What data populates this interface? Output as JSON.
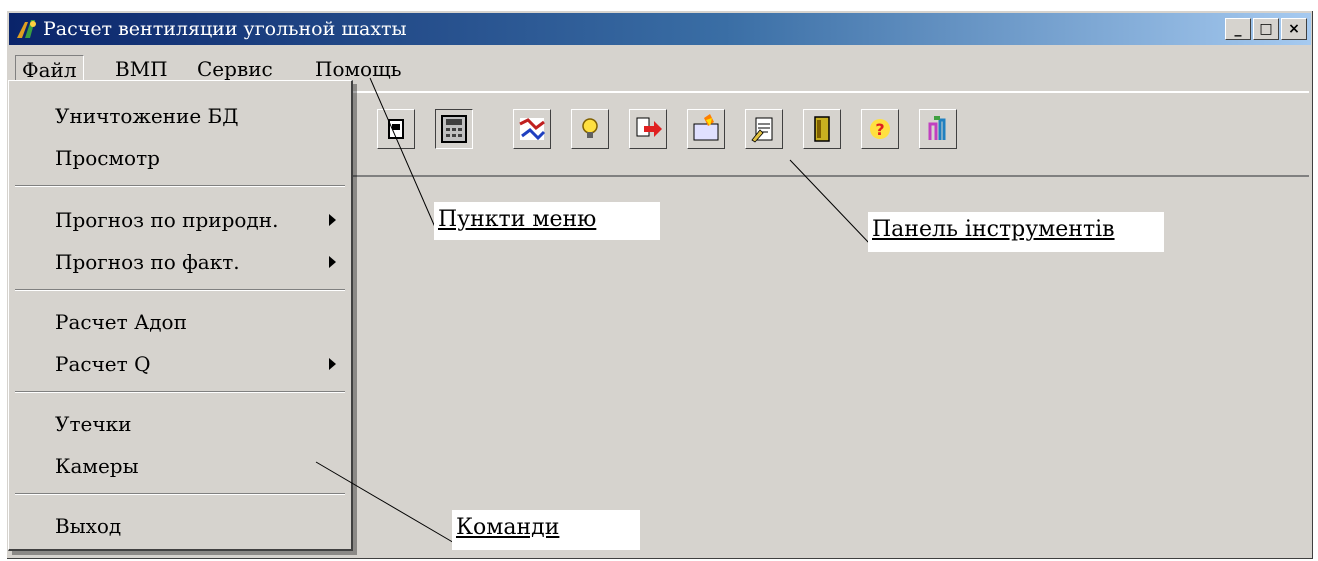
{
  "window": {
    "title": "Расчет вентиляции угольной шахты",
    "controls": [
      "_",
      "□",
      "×"
    ]
  },
  "menubar": {
    "items": [
      "Файл",
      "ВМП",
      "Сервис",
      "Помощь"
    ]
  },
  "dropdown": {
    "items": [
      {
        "label": "Уничтожение БД"
      },
      {
        "label": "Просмотр"
      },
      {
        "label": "Прогноз по природн."
      },
      {
        "label": "Прогноз по факт."
      },
      {
        "label": "Расчет Адоп"
      },
      {
        "label": "Расчет Q"
      },
      {
        "label": "Утечки"
      },
      {
        "label": "Камеры"
      },
      {
        "label": "Выход"
      }
    ]
  },
  "toolbar": {
    "buttons": [
      "list-icon",
      "calculator-icon",
      "map-icon",
      "lightbulb-icon",
      "export-arrow-icon",
      "fire-icon",
      "document-edit-icon",
      "door-icon",
      "help-icon",
      "chart-icon"
    ]
  },
  "callouts": {
    "menu_items": "Пункти меню",
    "toolbar": "Панель інструментів",
    "commands": "Команди"
  },
  "colors": {
    "window_bg": "#d6d3ce",
    "title_start": "#0a246a",
    "title_end": "#a6caf0"
  }
}
